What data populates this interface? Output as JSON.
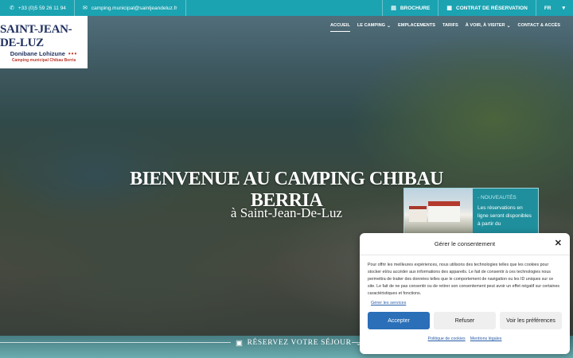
{
  "topbar": {
    "phone": "+33 (0)5 59 26 11 94",
    "email": "camping.municipal@saintjeandeluz.fr",
    "brochure": "BROCHURE",
    "reservation_contract": "CONTRAT DE RÉSERVATION",
    "language": "FR"
  },
  "logo": {
    "main": "SAINT-JEAN-DE-LUZ",
    "sub": "Donibane Lohizune",
    "dots": "•••",
    "tagline": "Camping municipal Chibau Berria"
  },
  "nav": {
    "items": [
      {
        "label": "ACCUEIL",
        "active": true
      },
      {
        "label": "LE CAMPING",
        "dropdown": true
      },
      {
        "label": "EMPLACEMENTS"
      },
      {
        "label": "TARIFS"
      },
      {
        "label": "À VOIR, À VISITER",
        "dropdown": true
      },
      {
        "label": "CONTACT & ACCÈS"
      }
    ]
  },
  "hero": {
    "title": "BIENVENUE AU CAMPING CHIBAU BERRIA",
    "subtitle": "à Saint-Jean-De-Luz"
  },
  "news": {
    "title": "- NOUVEAUTÉS",
    "text": "Les réservations en ligne seront disponibles à partir du"
  },
  "reserve": {
    "label": "RÉSERVEZ VOTRE SÉJOUR"
  },
  "consent": {
    "title": "Gérer le consentement",
    "body": "Pour offrir les meilleures expériences, nous utilisons des technologies telles que les cookies pour stocker et/ou accéder aux informations des appareils. Le fait de consentir à ces technologies nous permettra de traiter des données telles que le comportement de navigation ou les ID uniques sur ce site. Le fait de ne pas consentir ou de retirer son consentement peut avoir un effet négatif sur certaines caractéristiques et fonctions.",
    "manage_services": "Gérer les services",
    "accept": "Accepter",
    "refuse": "Refuser",
    "preferences": "Voir les préférences",
    "cookie_policy": "Politique de cookies",
    "legal": "Mentions légales"
  },
  "colors": {
    "topbar": "#1ba3b2",
    "news_card": "#1f8f9d",
    "accept_button": "#2a6fb8",
    "logo_text": "#1f2f5e",
    "logo_accent": "#c0392b"
  },
  "icons": {
    "phone": "phone-icon",
    "email": "email-icon",
    "brochure": "book-icon",
    "contract": "document-icon",
    "language_dropdown": "caret-down-icon",
    "calendar": "calendar-icon",
    "close": "close-icon"
  }
}
